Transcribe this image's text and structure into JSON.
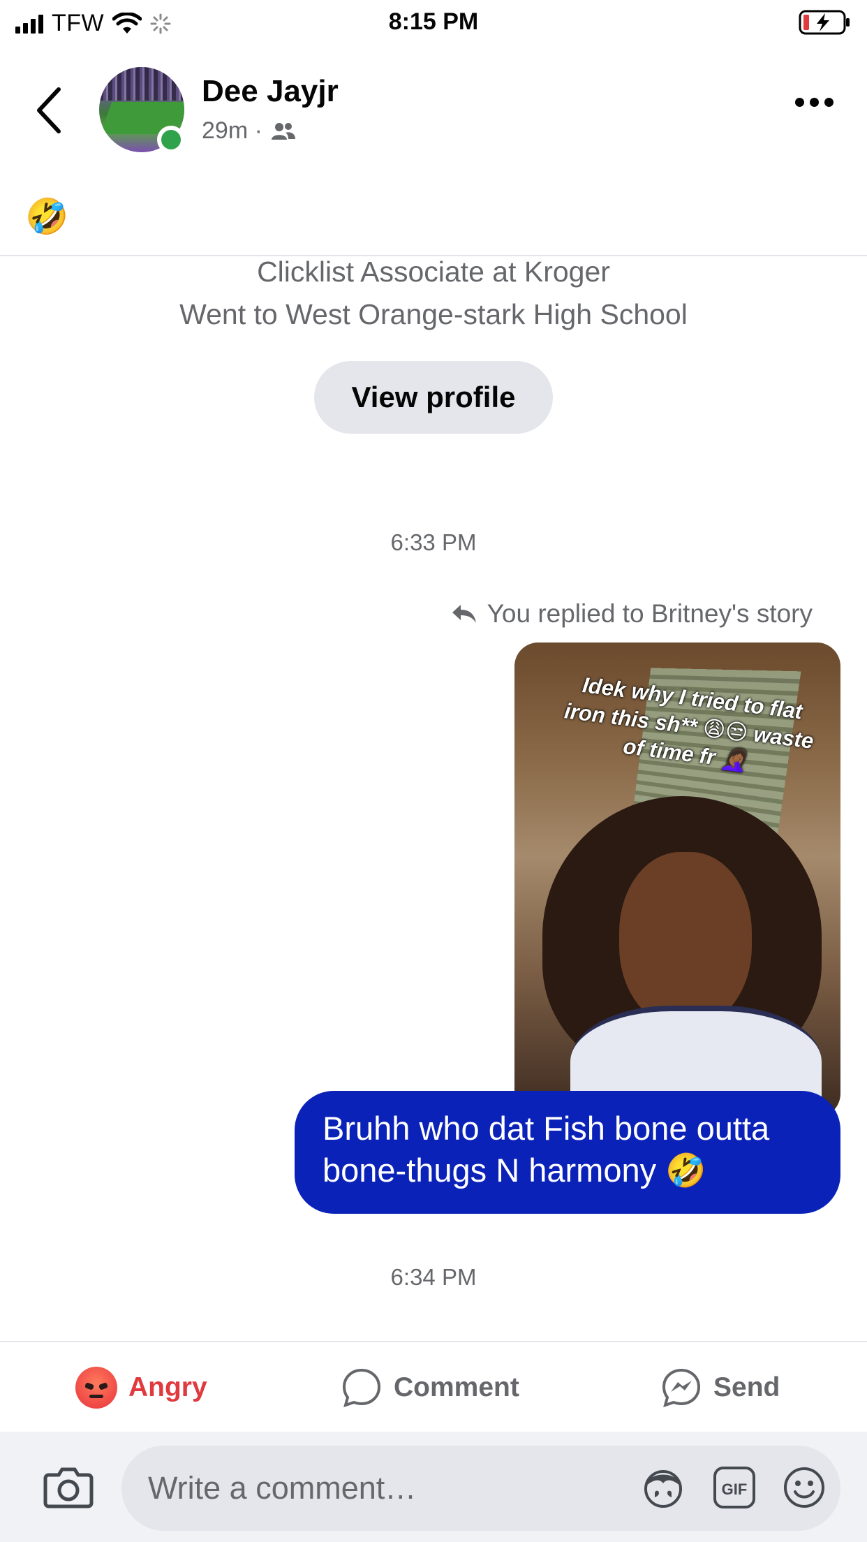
{
  "status_bar": {
    "carrier": "TFW",
    "time": "8:15 PM"
  },
  "header": {
    "name": "Dee Jayjr",
    "meta": "29m ·"
  },
  "top_emoji": "🤣",
  "profile": {
    "bio_lines": [
      "Clicklist Associate at Kroger",
      "Went to West Orange-stark High School"
    ],
    "view_profile_label": "View profile"
  },
  "conversation": {
    "timestamp_1": "6:33 PM",
    "reply_note": "You replied to Britney's story",
    "story_caption": "Idek why I tried to flat iron this sh** 😩😒 waste of time fr 🤦🏾‍♀️",
    "message": "Bruhh who dat Fish bone outta bone-thugs N harmony 🤣",
    "timestamp_2": "6:34 PM"
  },
  "actions": {
    "reaction_label": "Angry",
    "comment_label": "Comment",
    "send_label": "Send",
    "reaction_color": "#e0393e"
  },
  "composer": {
    "placeholder": "Write a comment…"
  },
  "colors": {
    "bubble": "#0b22b8",
    "secondary_text": "#65676b",
    "online": "#31a24c"
  }
}
